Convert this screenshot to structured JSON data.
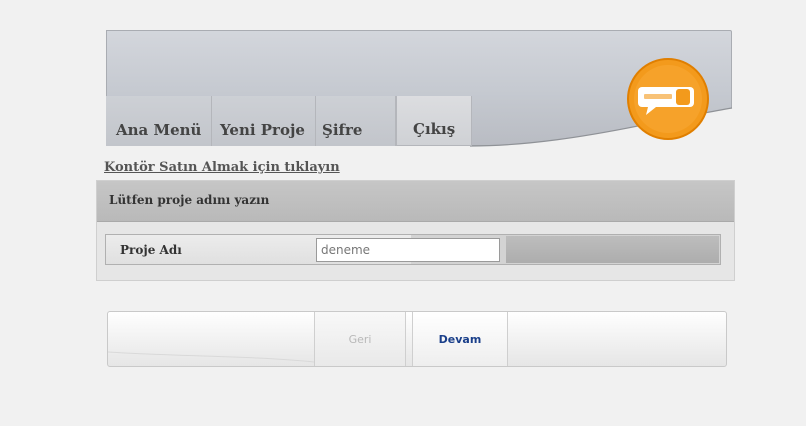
{
  "tabs": [
    {
      "label": "Ana Menü"
    },
    {
      "label": "Yeni Proje"
    },
    {
      "label": "Şifre"
    },
    {
      "label": "Çıkış"
    }
  ],
  "kontor_link": "Kontör Satın Almak için tıklayın",
  "form": {
    "title": "Lütfen proje adını yazın",
    "field_label": "Proje Adı",
    "field_value": "deneme"
  },
  "buttons": {
    "back_label": "Geri",
    "next_label": "Devam"
  },
  "colors": {
    "logo_orange": "#f39a1c",
    "link_blue": "#1a3f8a"
  }
}
